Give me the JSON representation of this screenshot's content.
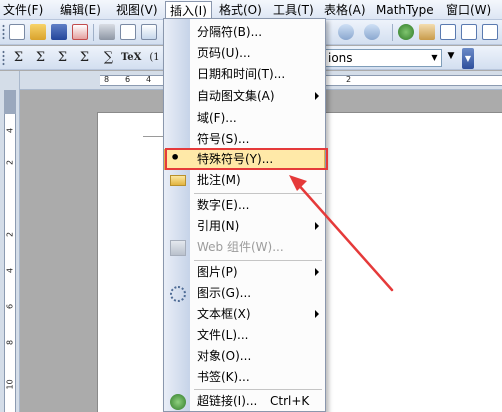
{
  "menubar": {
    "items": [
      {
        "id": "file",
        "label": "文件(F)"
      },
      {
        "id": "edit",
        "label": "编辑(E)"
      },
      {
        "id": "view",
        "label": "视图(V)"
      },
      {
        "id": "insert",
        "label": "插入(I)"
      },
      {
        "id": "format",
        "label": "格式(O)"
      },
      {
        "id": "tools",
        "label": "工具(T)"
      },
      {
        "id": "table",
        "label": "表格(A)"
      },
      {
        "id": "mathtype",
        "label": "MathType"
      },
      {
        "id": "window",
        "label": "窗口(W)"
      }
    ]
  },
  "toolbar": {
    "style_value": "ions"
  },
  "ruler": {
    "h_numbers": [
      "8",
      "6",
      "4",
      "2"
    ],
    "v_numbers": [
      "4",
      "2",
      "2",
      "4",
      "6",
      "8",
      "10"
    ]
  },
  "insert_menu": {
    "items": [
      {
        "label": "分隔符(B)...",
        "icon": null,
        "arrow": false,
        "disabled": false,
        "shortcut": ""
      },
      {
        "label": "页码(U)...",
        "icon": null,
        "arrow": false,
        "disabled": false,
        "shortcut": ""
      },
      {
        "label": "日期和时间(T)...",
        "icon": null,
        "arrow": false,
        "disabled": false,
        "shortcut": ""
      },
      {
        "label": "自动图文集(A)",
        "icon": null,
        "arrow": true,
        "disabled": false,
        "shortcut": ""
      },
      {
        "label": "域(F)...",
        "icon": null,
        "arrow": false,
        "disabled": false,
        "shortcut": ""
      },
      {
        "label": "符号(S)...",
        "icon": null,
        "arrow": false,
        "disabled": false,
        "shortcut": ""
      },
      {
        "label": "特殊符号(Y)...",
        "icon": "comma-icon",
        "arrow": false,
        "disabled": false,
        "shortcut": "",
        "highlighted": true
      },
      {
        "label": "批注(M)",
        "icon": "folder-icon",
        "arrow": false,
        "disabled": false,
        "shortcut": ""
      },
      {
        "label": "数字(E)...",
        "icon": null,
        "arrow": false,
        "disabled": false,
        "shortcut": ""
      },
      {
        "label": "引用(N)",
        "icon": null,
        "arrow": true,
        "disabled": false,
        "shortcut": ""
      },
      {
        "label": "Web 组件(W)...",
        "icon": "web-component-icon",
        "arrow": false,
        "disabled": true,
        "shortcut": ""
      },
      {
        "label": "图片(P)",
        "icon": null,
        "arrow": true,
        "disabled": false,
        "shortcut": ""
      },
      {
        "label": "图示(G)...",
        "icon": "diagram-icon",
        "arrow": false,
        "disabled": false,
        "shortcut": ""
      },
      {
        "label": "文本框(X)",
        "icon": null,
        "arrow": true,
        "disabled": false,
        "shortcut": ""
      },
      {
        "label": "文件(L)...",
        "icon": null,
        "arrow": false,
        "disabled": false,
        "shortcut": ""
      },
      {
        "label": "对象(O)...",
        "icon": null,
        "arrow": false,
        "disabled": false,
        "shortcut": ""
      },
      {
        "label": "书签(K)...",
        "icon": null,
        "arrow": false,
        "disabled": false,
        "shortcut": ""
      },
      {
        "label": "超链接(I)...",
        "icon": "hyperlink-icon",
        "arrow": false,
        "disabled": false,
        "shortcut": "Ctrl+K"
      }
    ]
  },
  "colors": {
    "highlight_fill": "#ffe9a8",
    "annotation_red": "#e53a3a"
  }
}
